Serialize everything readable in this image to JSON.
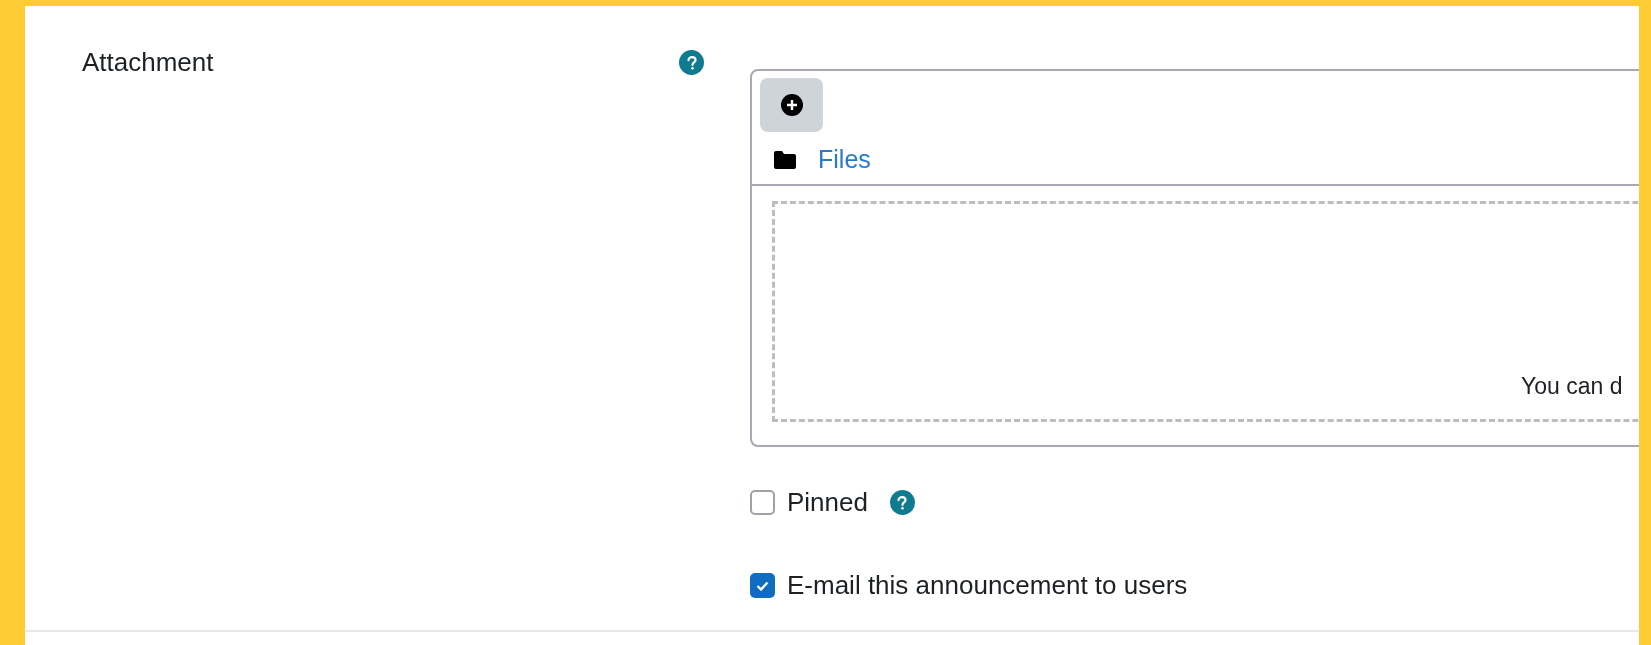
{
  "field": {
    "label": "Attachment",
    "help": true
  },
  "filepicker": {
    "folder": "Files",
    "dropzone_text": "You can d"
  },
  "options": [
    {
      "label": "Pinned",
      "checked": false,
      "help": true
    },
    {
      "label": "E-mail this announcement to users",
      "checked": true,
      "help": false
    }
  ]
}
